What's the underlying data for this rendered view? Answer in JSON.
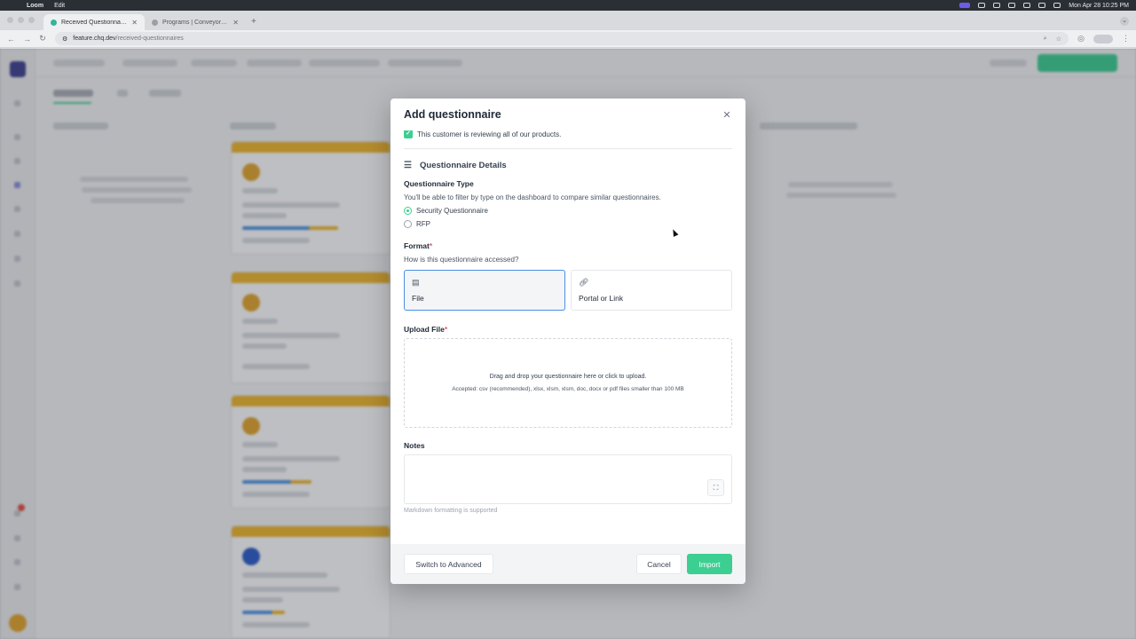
{
  "menubar": {
    "app_name": "Loom",
    "menu_edit": "Edit",
    "datetime": "Mon Apr 28  10:25 PM"
  },
  "browser": {
    "tabs": [
      {
        "title": "Received Questionnaires - C",
        "active": true
      },
      {
        "title": "Programs | Conveyor Internal",
        "active": false
      }
    ],
    "url_host": "feature.chq.dev",
    "url_path": "/received-questionnaires"
  },
  "modal": {
    "title": "Add questionnaire",
    "review_all_label": "This customer is reviewing all of our products.",
    "section_title": "Questionnaire Details",
    "type": {
      "label": "Questionnaire Type",
      "help": "You'll be able to filter by type on the dashboard to compare similar questionnaires.",
      "options": [
        {
          "label": "Security Questionnaire",
          "selected": true
        },
        {
          "label": "RFP",
          "selected": false
        }
      ]
    },
    "format": {
      "label": "Format",
      "required_mark": "*",
      "help": "How is this questionnaire accessed?",
      "options": [
        {
          "label": "File",
          "icon": "file-icon",
          "selected": true
        },
        {
          "label": "Portal or Link",
          "icon": "link-icon",
          "selected": false
        }
      ]
    },
    "upload": {
      "label": "Upload File",
      "required_mark": "*",
      "drop_text": "Drag and drop your questionnaire here or click to upload.",
      "accepted_text": "Accepted: csv (recommended), xlsx, xlsm, xlsm, doc, docx or pdf files smaller than 100 MB"
    },
    "notes": {
      "label": "Notes",
      "value": "",
      "hint": "Markdown formatting is supported"
    },
    "footer": {
      "advanced_label": "Switch to Advanced",
      "cancel_label": "Cancel",
      "import_label": "Import"
    }
  },
  "colors": {
    "accent_green": "#3ccf91",
    "selected_border": "#4a90e2",
    "required_red": "#e35d6a"
  }
}
